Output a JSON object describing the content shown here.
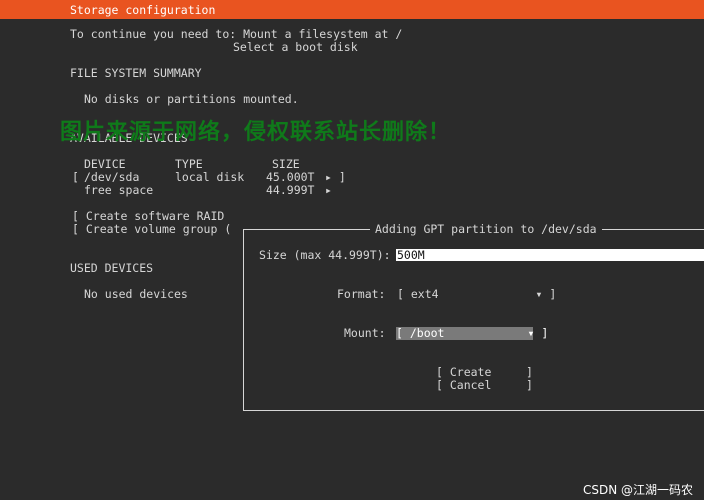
{
  "header": {
    "title": "Storage configuration"
  },
  "intro": {
    "line1": "To continue you need to: Mount a filesystem at /",
    "line2": "Select a boot disk"
  },
  "fs_summary": {
    "heading": "FILE SYSTEM SUMMARY",
    "empty_text": "No disks or partitions mounted."
  },
  "available": {
    "heading": "AVAILABLE DEVICES",
    "columns": {
      "device": "DEVICE",
      "type": "TYPE",
      "size": "SIZE"
    },
    "rows": [
      {
        "bracket": "[",
        "device": "/dev/sda",
        "type": "local disk",
        "size": "45.000T",
        "arrow": "▸ ]"
      },
      {
        "bracket": "",
        "device": "free space",
        "type": "",
        "size": "44.999T",
        "arrow": "▸"
      }
    ],
    "create_raid": "[ Create software RAID",
    "create_vg": "[ Create volume group ("
  },
  "used": {
    "heading": "USED DEVICES",
    "empty_text": "No used devices"
  },
  "watermark": "图片来源于网络，侵权联系站长删除！",
  "dialog": {
    "title": "Adding GPT partition to /dev/sda",
    "size_label": "Size (max 44.999T):",
    "size_value": "500M",
    "format_label": "Format:",
    "format_value": "[ ext4              ▾ ]",
    "mount_label": "Mount:",
    "mount_value": "[ /boot            ▾ ]",
    "create_label": "[ Create     ]",
    "cancel_label": "[ Cancel     ]"
  },
  "credit": "CSDN @江湖一码农"
}
